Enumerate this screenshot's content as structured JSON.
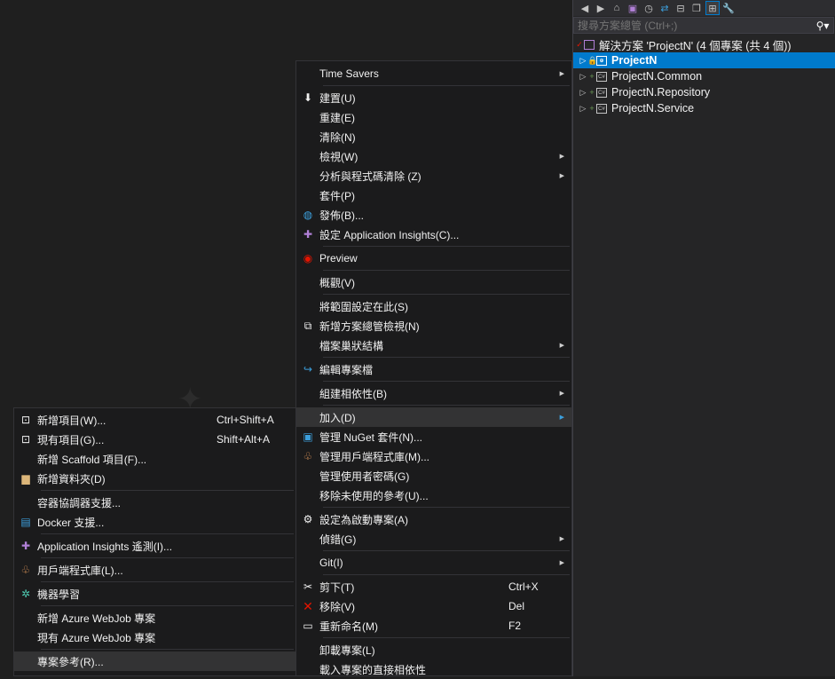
{
  "solution_explorer": {
    "search_placeholder": "搜尋方案總管 (Ctrl+;)",
    "solution_label": "解決方案 'ProjectN' (4 個專案 (共 4 個))",
    "projects": [
      {
        "name": "ProjectN",
        "selected": true
      },
      {
        "name": "ProjectN.Common",
        "selected": false
      },
      {
        "name": "ProjectN.Repository",
        "selected": false
      },
      {
        "name": "ProjectN.Service",
        "selected": false
      }
    ]
  },
  "context_menu": {
    "items": [
      {
        "id": "time-savers",
        "label": "Time Savers",
        "submenu": true
      },
      {
        "id": "build",
        "label": "建置(U)",
        "icon": "build-icon"
      },
      {
        "id": "rebuild",
        "label": "重建(E)"
      },
      {
        "id": "clean",
        "label": "清除(N)"
      },
      {
        "id": "view",
        "label": "檢視(W)",
        "submenu": true
      },
      {
        "id": "analyze",
        "label": "分析與程式碼清除 (Z)",
        "submenu": true
      },
      {
        "id": "pack",
        "label": "套件(P)"
      },
      {
        "id": "publish",
        "label": "發佈(B)...",
        "icon": "globe-icon"
      },
      {
        "id": "app-insights",
        "label": "設定 Application Insights(C)...",
        "icon": "lightbulb-icon"
      },
      {
        "id": "preview",
        "label": "Preview",
        "icon": "eye-icon"
      },
      {
        "id": "overview",
        "label": "概觀(V)"
      },
      {
        "id": "scope",
        "label": "將範圍設定在此(S)"
      },
      {
        "id": "new-se-view",
        "label": "新增方案總管檢視(N)",
        "icon": "new-view-icon"
      },
      {
        "id": "file-nesting",
        "label": "檔案巢狀結構",
        "submenu": true
      },
      {
        "id": "edit-project",
        "label": "編輯專案檔",
        "icon": "refresh-arrow-icon"
      },
      {
        "id": "build-deps",
        "label": "組建相依性(B)",
        "submenu": true
      },
      {
        "id": "add",
        "label": "加入(D)",
        "submenu": true,
        "highlighted": true
      },
      {
        "id": "manage-nuget",
        "label": "管理 NuGet 套件(N)...",
        "icon": "nuget-icon"
      },
      {
        "id": "manage-client-libs",
        "label": "管理用戶端程式庫(M)...",
        "icon": "client-lib-icon"
      },
      {
        "id": "user-secrets",
        "label": "管理使用者密碼(G)"
      },
      {
        "id": "remove-unused",
        "label": "移除未使用的參考(U)..."
      },
      {
        "id": "set-startup",
        "label": "設定為啟動專案(A)",
        "icon": "gear-icon"
      },
      {
        "id": "debug",
        "label": "偵錯(G)",
        "submenu": true
      },
      {
        "id": "git",
        "label": "Git(I)",
        "submenu": true
      },
      {
        "id": "cut",
        "label": "剪下(T)",
        "shortcut": "Ctrl+X",
        "icon": "scissors-icon"
      },
      {
        "id": "remove",
        "label": "移除(V)",
        "shortcut": "Del",
        "icon": "close-icon"
      },
      {
        "id": "rename",
        "label": "重新命名(M)",
        "shortcut": "F2",
        "icon": "rename-icon"
      },
      {
        "id": "unload",
        "label": "卸載專案(L)"
      },
      {
        "id": "load-deps",
        "label": "載入專案的直接相依性"
      }
    ]
  },
  "add_submenu": {
    "items": [
      {
        "id": "new-item",
        "label": "新增項目(W)...",
        "shortcut": "Ctrl+Shift+A",
        "icon": "new-item-icon"
      },
      {
        "id": "existing-item",
        "label": "現有項目(G)...",
        "shortcut": "Shift+Alt+A",
        "icon": "existing-item-icon"
      },
      {
        "id": "new-scaffold",
        "label": "新增 Scaffold 項目(F)..."
      },
      {
        "id": "new-folder",
        "label": "新增資料夾(D)",
        "icon": "folder-icon"
      },
      {
        "id": "container-orchestrator",
        "label": "容器協調器支援..."
      },
      {
        "id": "docker-support",
        "label": "Docker 支援...",
        "icon": "docker-icon"
      },
      {
        "id": "app-insights-telemetry",
        "label": "Application Insights 遙測(I)...",
        "icon": "lightbulb-icon"
      },
      {
        "id": "client-lib",
        "label": "用戶端程式庫(L)...",
        "icon": "client-lib-icon"
      },
      {
        "id": "ml",
        "label": "機器學習",
        "icon": "ml-icon"
      },
      {
        "id": "new-webjob",
        "label": "新增 Azure WebJob 專案"
      },
      {
        "id": "existing-webjob",
        "label": "現有 Azure WebJob 專案"
      },
      {
        "id": "project-reference",
        "label": "專案參考(R)...",
        "highlighted": true
      }
    ]
  }
}
